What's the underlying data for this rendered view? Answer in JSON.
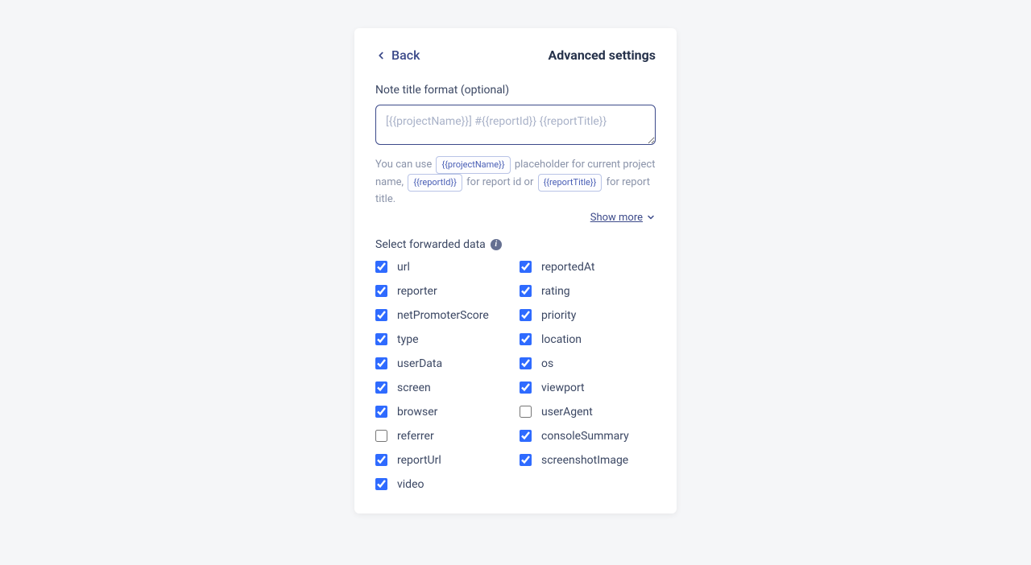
{
  "header": {
    "back_label": "Back",
    "title": "Advanced settings"
  },
  "noteTitle": {
    "label": "Note title format (optional)",
    "placeholder": "[{{projectName}}] #{{reportId}} {{reportTitle}}",
    "value": ""
  },
  "hint": {
    "prefix": "You can use ",
    "chip1": "{{projectName}}",
    "mid1": " placeholder for current project name, ",
    "chip2": "{{reportId}}",
    "mid2": " for report id or ",
    "chip3": "{{reportTitle}}",
    "suffix": " for report title."
  },
  "showMore": {
    "label": "Show more"
  },
  "forwardedData": {
    "label": "Select forwarded data",
    "items": [
      {
        "key": "url",
        "label": "url",
        "checked": true
      },
      {
        "key": "reportedAt",
        "label": "reportedAt",
        "checked": true
      },
      {
        "key": "reporter",
        "label": "reporter",
        "checked": true
      },
      {
        "key": "rating",
        "label": "rating",
        "checked": true
      },
      {
        "key": "netPromoterScore",
        "label": "netPromoterScore",
        "checked": true
      },
      {
        "key": "priority",
        "label": "priority",
        "checked": true
      },
      {
        "key": "type",
        "label": "type",
        "checked": true
      },
      {
        "key": "location",
        "label": "location",
        "checked": true
      },
      {
        "key": "userData",
        "label": "userData",
        "checked": true
      },
      {
        "key": "os",
        "label": "os",
        "checked": true
      },
      {
        "key": "screen",
        "label": "screen",
        "checked": true
      },
      {
        "key": "viewport",
        "label": "viewport",
        "checked": true
      },
      {
        "key": "browser",
        "label": "browser",
        "checked": true
      },
      {
        "key": "userAgent",
        "label": "userAgent",
        "checked": false
      },
      {
        "key": "referrer",
        "label": "referrer",
        "checked": false
      },
      {
        "key": "consoleSummary",
        "label": "consoleSummary",
        "checked": true
      },
      {
        "key": "reportUrl",
        "label": "reportUrl",
        "checked": true
      },
      {
        "key": "screenshotImage",
        "label": "screenshotImage",
        "checked": true
      },
      {
        "key": "video",
        "label": "video",
        "checked": true
      }
    ]
  }
}
